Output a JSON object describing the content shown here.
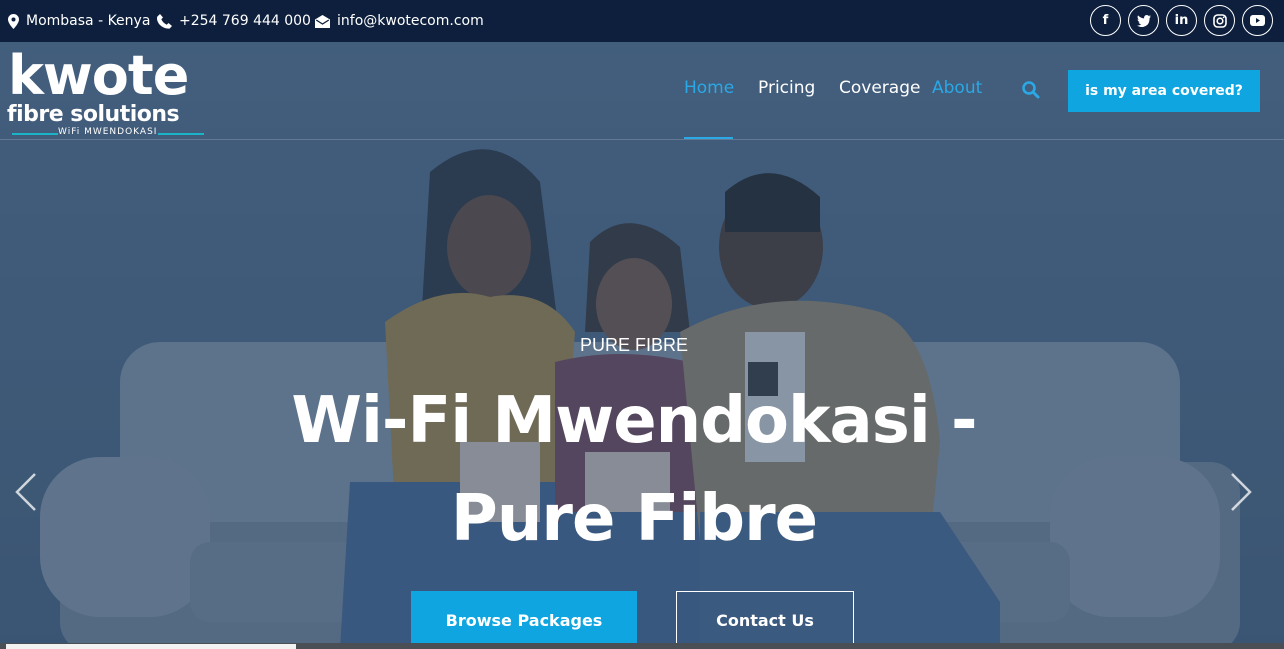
{
  "topbar": {
    "location": "Mombasa - Kenya",
    "phone": "+254 769 444 000",
    "email": "info@kwotecom.com",
    "socials": [
      {
        "icon": "facebook-icon",
        "glyph": "f"
      },
      {
        "icon": "twitter-icon",
        "glyph": "t"
      },
      {
        "icon": "linkedin-icon",
        "glyph": "in"
      },
      {
        "icon": "instagram-icon",
        "glyph": "◎"
      },
      {
        "icon": "youtube-icon",
        "glyph": "▶"
      }
    ]
  },
  "logo": {
    "word": "kwote",
    "sub": "fibre solutions",
    "tag": "WiFi MWENDOKASI"
  },
  "nav": {
    "items": [
      {
        "label": "Home",
        "active": true
      },
      {
        "label": "Pricing"
      },
      {
        "label": "Coverage"
      },
      {
        "label": "About"
      }
    ],
    "cta": "is my area covered?"
  },
  "hero": {
    "eyebrow": "PURE FIBRE",
    "title_line1": "Wi-Fi Mwendokasi -",
    "title_line2": "Pure Fibre",
    "primary_button": "Browse Packages",
    "secondary_button": "Contact Us"
  },
  "colors": {
    "topbar_bg": "#0d1f3c",
    "accent": "#0ea5e0",
    "nav_active": "#2aa9e6",
    "logo_accent": "#1ab3c8"
  }
}
